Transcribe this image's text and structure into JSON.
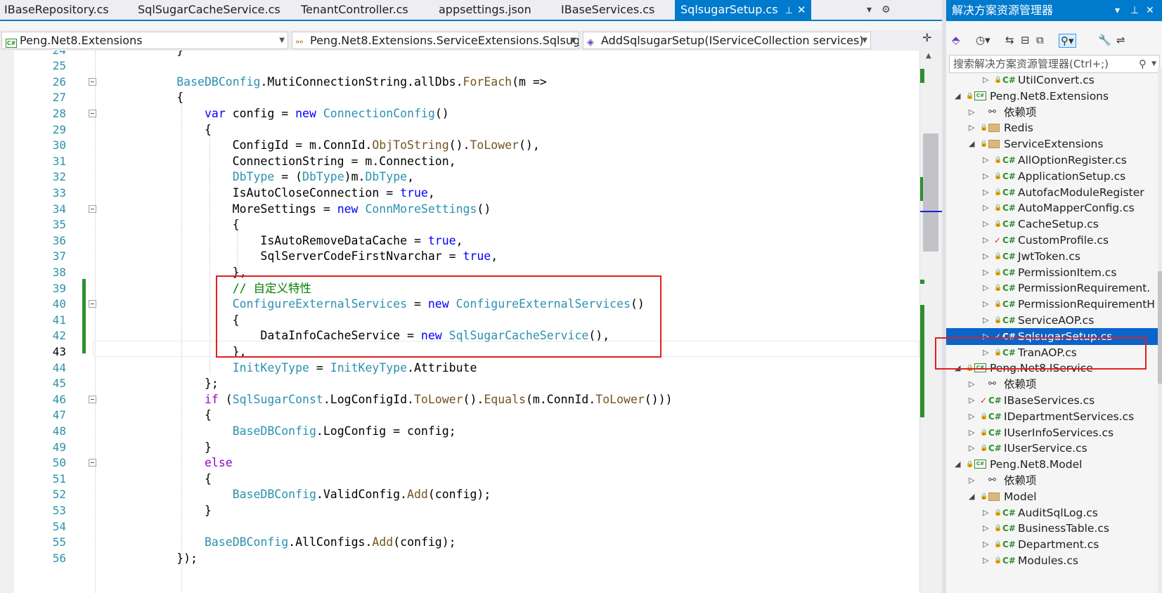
{
  "tabs": [
    {
      "label": "IBaseRepository.cs"
    },
    {
      "label": "SqlSugarCacheService.cs"
    },
    {
      "label": "TenantController.cs"
    },
    {
      "label": "appsettings.json"
    },
    {
      "label": "IBaseServices.cs"
    },
    {
      "label": "SqlsugarSetup.cs",
      "active": true
    }
  ],
  "tab_controls": {
    "pin": "⊥",
    "close": "✕",
    "dropdown": "▾",
    "settings": "⚙"
  },
  "navbar": {
    "project": "Peng.Net8.Extensions",
    "type": "Peng.Net8.Extensions.ServiceExtensions.SqlsugarSetu",
    "member": "AddSqlsugarSetup(IServiceCollection services)"
  },
  "editor": {
    "current_line": 43,
    "lines": [
      {
        "n": "24",
        "text": "            }"
      },
      {
        "n": "25",
        "text": ""
      },
      {
        "n": "26",
        "text": "            BaseDBConfig.MutiConnectionString.allDbs.ForEach(m =>"
      },
      {
        "n": "27",
        "text": "            {"
      },
      {
        "n": "28",
        "text": "                var config = new ConnectionConfig()"
      },
      {
        "n": "29",
        "text": "                {"
      },
      {
        "n": "30",
        "text": "                    ConfigId = m.ConnId.ObjToString().ToLower(),"
      },
      {
        "n": "31",
        "text": "                    ConnectionString = m.Connection,"
      },
      {
        "n": "32",
        "text": "                    DbType = (DbType)m.DbType,"
      },
      {
        "n": "33",
        "text": "                    IsAutoCloseConnection = true,"
      },
      {
        "n": "34",
        "text": "                    MoreSettings = new ConnMoreSettings()"
      },
      {
        "n": "35",
        "text": "                    {"
      },
      {
        "n": "36",
        "text": "                        IsAutoRemoveDataCache = true,"
      },
      {
        "n": "37",
        "text": "                        SqlServerCodeFirstNvarchar = true,"
      },
      {
        "n": "38",
        "text": "                    },"
      },
      {
        "n": "39",
        "text": "                    // 自定义特性"
      },
      {
        "n": "40",
        "text": "                    ConfigureExternalServices = new ConfigureExternalServices()"
      },
      {
        "n": "41",
        "text": "                    {"
      },
      {
        "n": "42",
        "text": "                        DataInfoCacheService = new SqlSugarCacheService(),"
      },
      {
        "n": "43",
        "text": "                    },"
      },
      {
        "n": "44",
        "text": "                    InitKeyType = InitKeyType.Attribute"
      },
      {
        "n": "45",
        "text": "                };"
      },
      {
        "n": "46",
        "text": "                if (SqlSugarConst.LogConfigId.ToLower().Equals(m.ConnId.ToLower()))"
      },
      {
        "n": "47",
        "text": "                {"
      },
      {
        "n": "48",
        "text": "                    BaseDBConfig.LogConfig = config;"
      },
      {
        "n": "49",
        "text": "                }"
      },
      {
        "n": "50",
        "text": "                else"
      },
      {
        "n": "51",
        "text": "                {"
      },
      {
        "n": "52",
        "text": "                    BaseDBConfig.ValidConfig.Add(config);"
      },
      {
        "n": "53",
        "text": "                }"
      },
      {
        "n": "54",
        "text": ""
      },
      {
        "n": "55",
        "text": "                BaseDBConfig.AllConfigs.Add(config);"
      },
      {
        "n": "56",
        "text": "            });"
      }
    ]
  },
  "solution_explorer": {
    "title": "解决方案资源管理器",
    "title_controls": {
      "dropdown": "▾",
      "pin": "⊥",
      "close": "✕"
    },
    "search_placeholder": "搜索解决方案资源管理器(Ctrl+;)",
    "toolbar_icons": [
      "vs-icon",
      "history-icon",
      "sync-icon",
      "collapse-icon",
      "copy-icon",
      "filter-icon",
      "wrench-icon",
      "preview-icon"
    ],
    "items": [
      {
        "label": "UtilConvert.cs",
        "kind": "cs",
        "level": 2,
        "expander": "▷"
      },
      {
        "label": "Peng.Net8.Extensions",
        "kind": "project",
        "level": 0,
        "expander": "◢"
      },
      {
        "label": "依赖项",
        "kind": "deps",
        "level": 1,
        "expander": "▷"
      },
      {
        "label": "Redis",
        "kind": "folder",
        "level": 1,
        "expander": "▷"
      },
      {
        "label": "ServiceExtensions",
        "kind": "folder",
        "level": 1,
        "expander": "◢"
      },
      {
        "label": "AllOptionRegister.cs",
        "kind": "cs",
        "level": 2,
        "expander": "▷"
      },
      {
        "label": "ApplicationSetup.cs",
        "kind": "cs",
        "level": 2,
        "expander": "▷"
      },
      {
        "label": "AutofacModuleRegister",
        "kind": "cs",
        "level": 2,
        "expander": "▷"
      },
      {
        "label": "AutoMapperConfig.cs",
        "kind": "cs",
        "level": 2,
        "expander": "▷"
      },
      {
        "label": "CacheSetup.cs",
        "kind": "cs",
        "level": 2,
        "expander": "▷"
      },
      {
        "label": "CustomProfile.cs",
        "kind": "cs",
        "level": 2,
        "expander": "▷",
        "checked": true
      },
      {
        "label": "JwtToken.cs",
        "kind": "cs",
        "level": 2,
        "expander": "▷"
      },
      {
        "label": "PermissionItem.cs",
        "kind": "cs",
        "level": 2,
        "expander": "▷"
      },
      {
        "label": "PermissionRequirement.",
        "kind": "cs",
        "level": 2,
        "expander": "▷"
      },
      {
        "label": "PermissionRequirementH",
        "kind": "cs",
        "level": 2,
        "expander": "▷"
      },
      {
        "label": "ServiceAOP.cs",
        "kind": "cs",
        "level": 2,
        "expander": "▷"
      },
      {
        "label": "SqlsugarSetup.cs",
        "kind": "cs",
        "level": 2,
        "expander": "▷",
        "checked": true,
        "selected": true
      },
      {
        "label": "TranAOP.cs",
        "kind": "cs",
        "level": 2,
        "expander": "▷"
      },
      {
        "label": "Peng.Net8.IService",
        "kind": "project",
        "level": 0,
        "expander": "◢"
      },
      {
        "label": "依赖项",
        "kind": "deps",
        "level": 1,
        "expander": "▷"
      },
      {
        "label": "IBaseServices.cs",
        "kind": "cs",
        "level": 1,
        "expander": "▷",
        "checked": true
      },
      {
        "label": "IDepartmentServices.cs",
        "kind": "cs",
        "level": 1,
        "expander": "▷"
      },
      {
        "label": "IUserInfoServices.cs",
        "kind": "cs",
        "level": 1,
        "expander": "▷"
      },
      {
        "label": "IUserService.cs",
        "kind": "cs",
        "level": 1,
        "expander": "▷"
      },
      {
        "label": "Peng.Net8.Model",
        "kind": "project",
        "level": 0,
        "expander": "◢"
      },
      {
        "label": "依赖项",
        "kind": "deps",
        "level": 1,
        "expander": "▷"
      },
      {
        "label": "Model",
        "kind": "folder",
        "level": 1,
        "expander": "◢"
      },
      {
        "label": "AuditSqlLog.cs",
        "kind": "cs",
        "level": 2,
        "expander": "▷"
      },
      {
        "label": "BusinessTable.cs",
        "kind": "cs",
        "level": 2,
        "expander": "▷"
      },
      {
        "label": "Department.cs",
        "kind": "cs",
        "level": 2,
        "expander": "▷"
      },
      {
        "label": "Modules.cs",
        "kind": "cs",
        "level": 2,
        "expander": "▷"
      }
    ]
  },
  "colors": {
    "accent": "#007acc",
    "selection": "#0a64c9",
    "highlight_box": "#e02020",
    "keyword": "#0000ff",
    "type": "#2b91af",
    "comment": "#008000"
  }
}
